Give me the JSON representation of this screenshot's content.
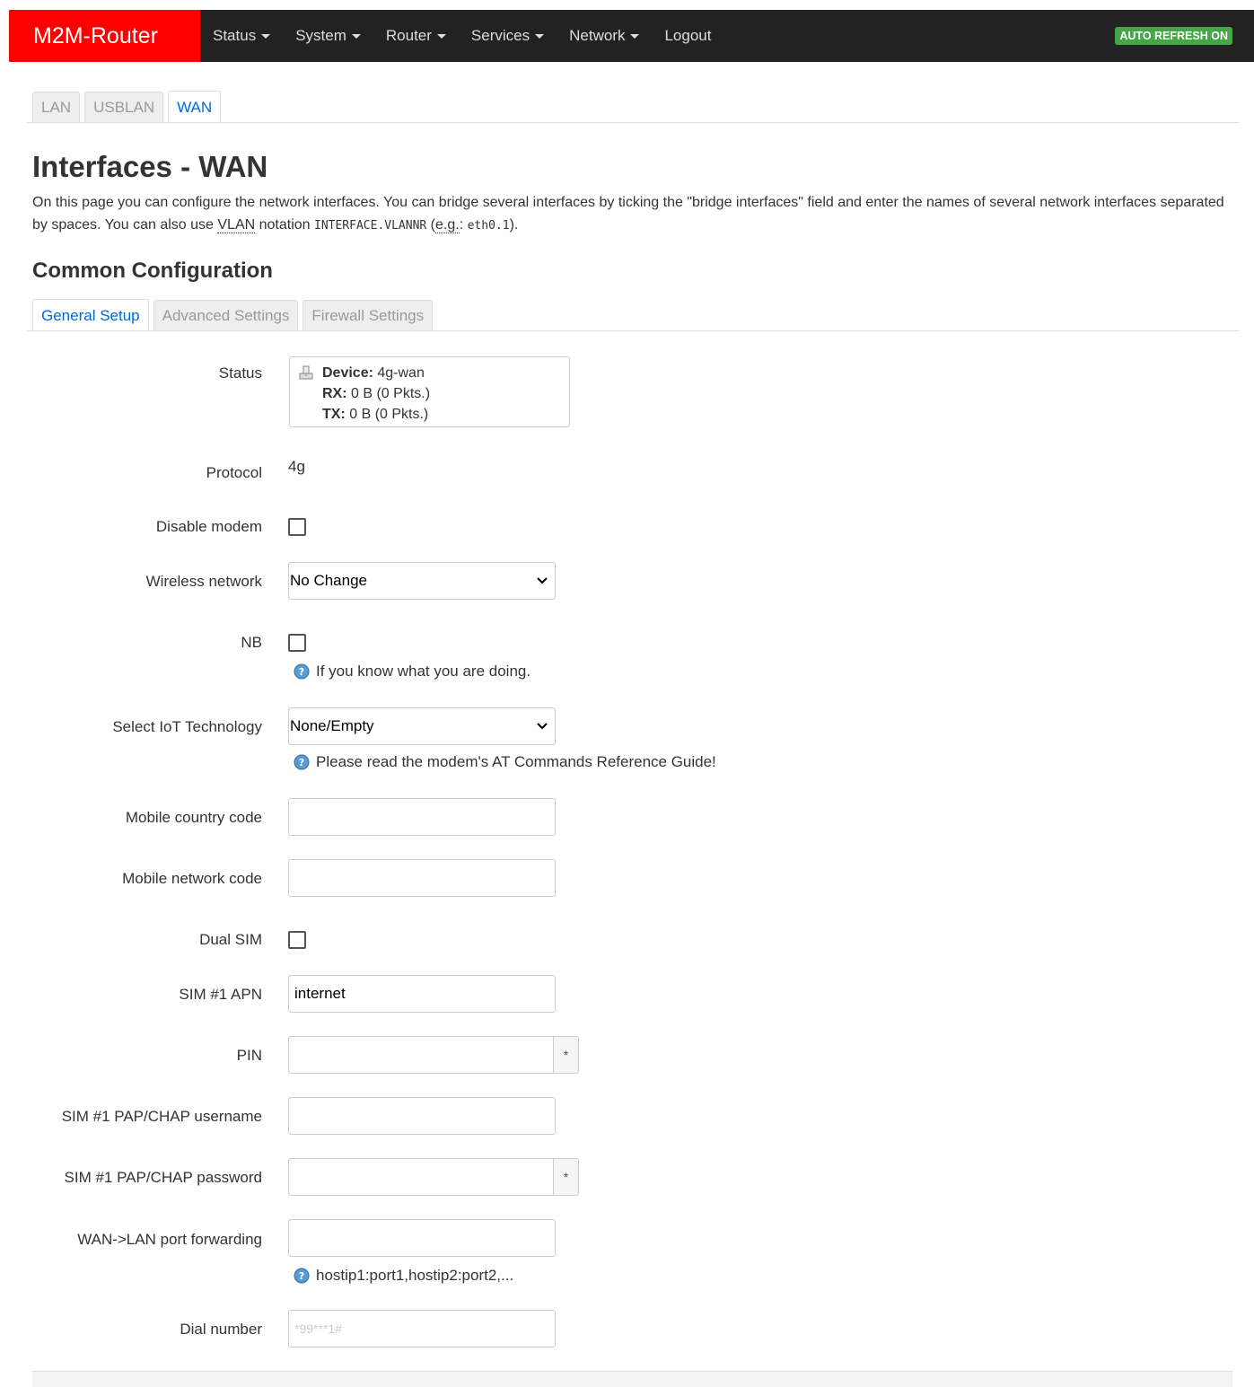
{
  "navbar": {
    "brand": "M2M-Router",
    "menu": [
      {
        "label": "Status",
        "dropdown": true
      },
      {
        "label": "System",
        "dropdown": true
      },
      {
        "label": "Router",
        "dropdown": true
      },
      {
        "label": "Services",
        "dropdown": true
      },
      {
        "label": "Network",
        "dropdown": true
      },
      {
        "label": "Logout",
        "dropdown": false
      }
    ],
    "refresh_badge": "AUTO REFRESH ON",
    "brand_color": "#ff0000",
    "badge_color": "#46a546"
  },
  "interface_tabs": [
    "LAN",
    "USBLAN",
    "WAN"
  ],
  "interface_tabs_active": "WAN",
  "page": {
    "title": "Interfaces - WAN",
    "desc_part1": "On this page you can configure the network interfaces. You can bridge several interfaces by ticking the \"bridge interfaces\" field and enter the names of several network interfaces separated by spaces. You can also use ",
    "desc_vlan": "VLAN",
    "desc_part2": " notation ",
    "desc_code1": "INTERFACE.VLANNR",
    "desc_part3": " (",
    "desc_eg": "e.g.",
    "desc_part4": ": ",
    "desc_code2": "eth0.1",
    "desc_part5": ").",
    "section_title": "Common Configuration"
  },
  "config_tabs": [
    "General Setup",
    "Advanced Settings",
    "Firewall Settings"
  ],
  "config_tabs_active": "General Setup",
  "form": {
    "status_label": "Status",
    "status": {
      "device_key": "Device:",
      "device_val": "4g-wan",
      "rx_key": "RX:",
      "rx_val": "0 B (0 Pkts.)",
      "tx_key": "TX:",
      "tx_val": "0 B (0 Pkts.)"
    },
    "protocol_label": "Protocol",
    "protocol_value": "4g",
    "disable_modem_label": "Disable modem",
    "disable_modem_checked": false,
    "wireless_network_label": "Wireless network",
    "wireless_network_value": "No Change",
    "nb_label": "NB",
    "nb_checked": false,
    "nb_help": "If you know what you are doing.",
    "iot_label": "Select IoT Technology",
    "iot_value": "None/Empty",
    "iot_help": "Please read the modem's AT Commands Reference Guide!",
    "mcc_label": "Mobile country code",
    "mcc_value": "",
    "mnc_label": "Mobile network code",
    "mnc_value": "",
    "dual_sim_label": "Dual SIM",
    "dual_sim_checked": false,
    "apn_label": "SIM #1 APN",
    "apn_value": "internet",
    "pin_label": "PIN",
    "pin_value": "",
    "reveal_symbol": "*",
    "user_label": "SIM #1 PAP/CHAP username",
    "user_value": "",
    "pass_label": "SIM #1 PAP/CHAP password",
    "pass_value": "",
    "fwd_label": "WAN->LAN port forwarding",
    "fwd_value": "",
    "fwd_help": "hostip1:port1,hostip2:port2,...",
    "dial_label": "Dial number",
    "dial_placeholder": "*99***1#"
  }
}
